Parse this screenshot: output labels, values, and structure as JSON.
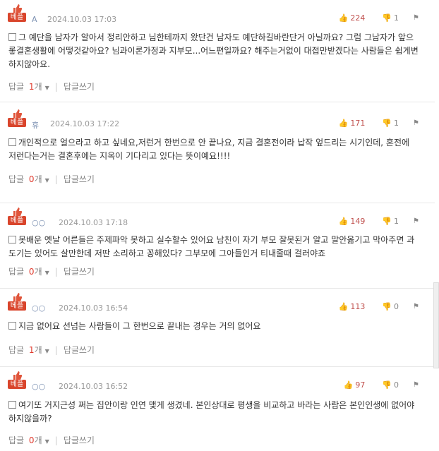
{
  "comments": [
    {
      "badge": "베플",
      "author": "A",
      "date": "2024.10.03 17:03",
      "up": "224",
      "down": "1",
      "text": "그 예단을 남자가 알아서 정리안하고 님한테까지 왔단건 남자도 예단하길바란단거 아닐까요? 그럼 그남자가 앞으롷결혼생활에 어떻것같아요? 님과이론가정과 지부모...어느편일까요? 해주는거없이 대접만받겠다는 사람들은 쉽게변하지않아요.",
      "reply_label": "답글",
      "reply_count": "1",
      "reply_unit": "개",
      "write_reply": "답글쓰기"
    },
    {
      "badge": "베플",
      "author": "휴",
      "date": "2024.10.03 17:22",
      "up": "171",
      "down": "1",
      "text": "개인적으로 얼으라고 하고 싶네요,저런거 한번으로 안 끝나요, 지금 결혼전이라 납작 엎드리는 시기인데, 혼전에 저런다는거는 결혼후에는 지옥이 기다리고 있다는 뜻이예요!!!!",
      "reply_label": "답글",
      "reply_count": "0",
      "reply_unit": "개",
      "write_reply": "답글쓰기"
    },
    {
      "badge": "베플",
      "author": "○○",
      "date": "2024.10.03 17:18",
      "up": "149",
      "down": "1",
      "text": "못배운 옛날 어른들은 주제파악 못하고 실수할수 있어요 남친이 자기 부모 잘못된거 알고 말안옮기고 막아주면 과도기는 있어도 살만한데 저딴 소리하고 꽁해있다? 그부모에 그아들인거 티내줄때 걸러야죠",
      "reply_label": "답글",
      "reply_count": "0",
      "reply_unit": "개",
      "write_reply": "답글쓰기"
    },
    {
      "badge": "베플",
      "author": "○○",
      "date": "2024.10.03 16:54",
      "up": "113",
      "down": "0",
      "text": "지금 없어요 선넘는 사람들이 그 한번으로 끝내는 경우는 거의 없어요",
      "reply_label": "답글",
      "reply_count": "1",
      "reply_unit": "개",
      "write_reply": "답글쓰기"
    },
    {
      "badge": "베플",
      "author": "○○",
      "date": "2024.10.03 16:52",
      "up": "97",
      "down": "0",
      "text": "여기또 거지근성 쩌는 집안이랑 인연 맺게 생겼네. 본인상대로 평생을 비교하고 바라는 사람은 본인인생에 없어야하지않을까?",
      "reply_label": "답글",
      "reply_count": "0",
      "reply_unit": "개",
      "write_reply": "답글쓰기"
    }
  ],
  "icons": {
    "thumb": "thumb-up-icon",
    "like": "like-icon",
    "dislike": "dislike-icon",
    "report": "report-icon",
    "memo": "memo-icon"
  },
  "colors": {
    "badge": "#d9452c",
    "up": "#c0504d",
    "count": "#e03b2e",
    "author": "#7a8fb1"
  }
}
